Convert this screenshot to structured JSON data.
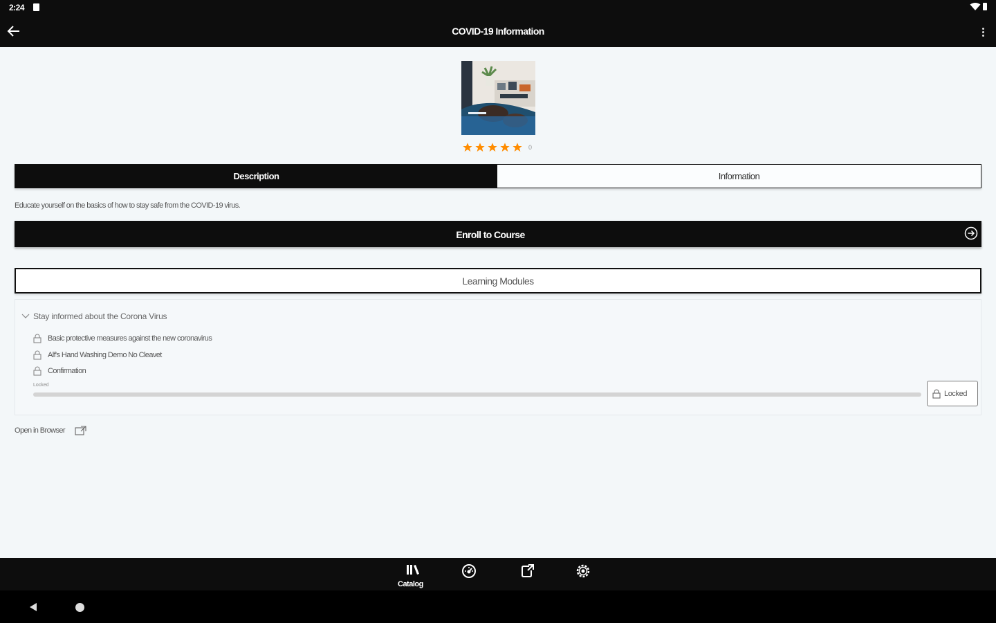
{
  "status_bar": {
    "time": "2:24"
  },
  "app_bar": {
    "title": "COVID-19 Information"
  },
  "course": {
    "rating_count": "0",
    "stars": 5,
    "tabs": [
      {
        "label": "Description",
        "active": true
      },
      {
        "label": "Information",
        "active": false
      }
    ],
    "description": "Educate yourself on the basics of how to stay safe from the COVID-19 virus.",
    "enroll_label": "Enroll to Course"
  },
  "modules": {
    "header": "Learning Modules",
    "section_title": "Stay informed about the Corona Virus",
    "lessons": [
      {
        "label": "Basic protective measures against the new coronavirus",
        "icon": "lock-icon"
      },
      {
        "label": "Alf's Hand Washing Demo No Cleavet",
        "icon": "lock-icon"
      },
      {
        "label": "Confirmation",
        "icon": "lock-icon"
      }
    ],
    "progress_label": "Locked",
    "progress": 0,
    "locked_button": "Locked"
  },
  "open_browser": {
    "label": "Open in Browser"
  },
  "bottom_nav": {
    "items": [
      {
        "label": "Catalog",
        "icon": "catalog-icon",
        "active": true
      },
      {
        "label": "",
        "icon": "dashboard-icon"
      },
      {
        "label": "",
        "icon": "external-share-icon"
      },
      {
        "label": "",
        "icon": "settings-icon"
      }
    ]
  },
  "colors": {
    "accent_dark": "#0d0d0d",
    "background": "#f3f7f9",
    "star": "#ff8c00"
  }
}
